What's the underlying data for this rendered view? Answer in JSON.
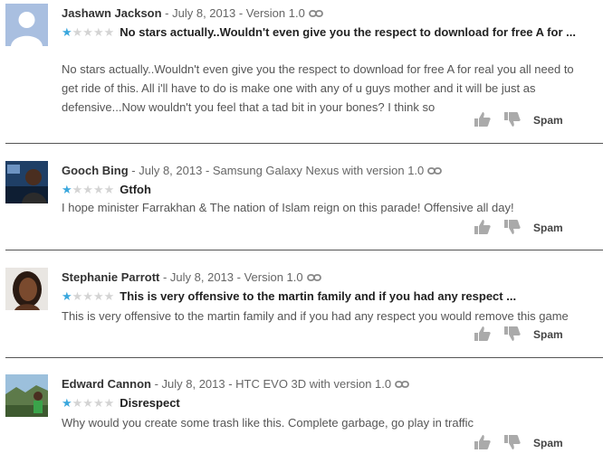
{
  "reviews": [
    {
      "author": "Jashawn Jackson",
      "meta": " - July 8, 2013 - Version 1.0",
      "rating": 1,
      "title": "No stars actually..Wouldn't even give you the respect to download for free A for ...",
      "body": "No stars actually..Wouldn't even give you the respect to download for free A for real you all need to get ride of this. All i'll have to do is make one with any of u guys mother and it will be just as defensive...Now wouldn't you feel that a tad bit in your bones? I think so",
      "spam_label": "Spam",
      "avatar": "default-avatar"
    },
    {
      "author": "Gooch Bing",
      "meta": " - July 8, 2013 - Samsung Galaxy Nexus with version 1.0",
      "rating": 1,
      "title": "Gtfoh",
      "body": "I hope minister Farrakhan & The nation of Islam reign on this parade! Offensive all day!",
      "spam_label": "Spam",
      "avatar": "photo"
    },
    {
      "author": "Stephanie Parrott",
      "meta": " - July 8, 2013 - Version 1.0",
      "rating": 1,
      "title": "This is very offensive to the martin family and if you had any respect ...",
      "body": "This is very offensive to the martin family and if you had any respect you would remove this game",
      "spam_label": "Spam",
      "avatar": "photo"
    },
    {
      "author": "Edward Cannon",
      "meta": " - July 8, 2013 - HTC EVO 3D with version 1.0",
      "rating": 1,
      "title": "Disrespect",
      "body": "Why would you create some trash like this. Complete garbage, go play in traffic",
      "spam_label": "Spam",
      "avatar": "photo"
    }
  ],
  "colors": {
    "star_on": "#3aa7dd",
    "star_off": "#d4d4d4",
    "divider": "#555555"
  }
}
